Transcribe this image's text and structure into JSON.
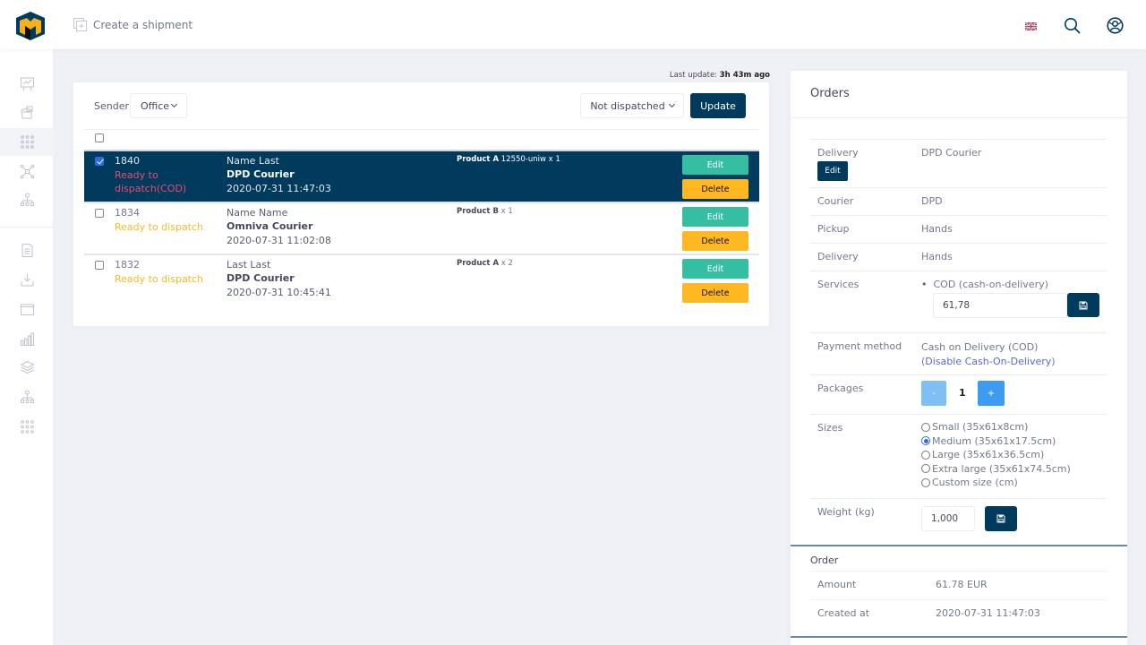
{
  "topbar": {
    "create_label": "Create a shipment",
    "icons": [
      "logo",
      "create-shipment-icon",
      "uk-flag-icon",
      "search-icon",
      "user-globe-icon"
    ]
  },
  "sidebar": {
    "items": [
      {
        "name": "dashboard",
        "icon": "presentation-chart-icon",
        "active": false
      },
      {
        "name": "packages",
        "icon": "boxes-icon",
        "active": false
      },
      {
        "name": "apps",
        "icon": "grid-dots-icon",
        "active": true
      },
      {
        "name": "network",
        "icon": "network-nodes-icon",
        "active": false
      },
      {
        "name": "hierarchy",
        "icon": "sitemap-icon",
        "active": false
      },
      {
        "name": "documents",
        "icon": "document-icon",
        "active": false
      },
      {
        "name": "import",
        "icon": "download-icon",
        "active": false
      },
      {
        "name": "windows",
        "icon": "window-icon",
        "active": false
      },
      {
        "name": "stats",
        "icon": "bar-chart-icon",
        "active": false
      },
      {
        "name": "layers",
        "icon": "layers-icon",
        "active": false
      },
      {
        "name": "structure",
        "icon": "sitemap-icon",
        "active": false
      },
      {
        "name": "more",
        "icon": "grid-dots-icon",
        "active": false
      }
    ]
  },
  "last_update": {
    "label": "Last update:",
    "value": "3h 43m ago"
  },
  "filters": {
    "sender_label": "Sender",
    "sender_value": "Office",
    "status_value": "Not dispatched",
    "update_label": "Update"
  },
  "orders": [
    {
      "id": "1840",
      "status": "Ready to dispatch(COD)",
      "status_type": "cod",
      "name": "Name Last",
      "courier": "DPD Courier",
      "date": "2020-07-31 11:47:03",
      "product": "Product A",
      "product_extra": "12550-uniw x 1",
      "selected": true,
      "edit_label": "Edit",
      "delete_label": "Delete"
    },
    {
      "id": "1834",
      "status": "Ready to dispatch",
      "status_type": "ready",
      "name": "Name Name",
      "courier": "Omniva Courier",
      "date": "2020-07-31 11:02:08",
      "product": "Product B",
      "product_extra": "x 1",
      "selected": false,
      "edit_label": "Edit",
      "delete_label": "Delete"
    },
    {
      "id": "1832",
      "status": "Ready to dispatch",
      "status_type": "ready",
      "name": "Last Last",
      "courier": "DPD Courier",
      "date": "2020-07-31 10:45:41",
      "product": "Product A",
      "product_extra": "x 2",
      "selected": false,
      "edit_label": "Edit",
      "delete_label": "Delete"
    }
  ],
  "details": {
    "title": "Orders",
    "delivery_label": "Delivery",
    "delivery_value": "DPD Courier",
    "delivery_edit": "Edit",
    "courier_label": "Courier",
    "courier_value": "DPD",
    "pickup_label": "Pickup",
    "pickup_value": "Hands",
    "delivery2_label": "Delivery",
    "delivery2_value": "Hands",
    "services_label": "Services",
    "service_item": "COD (cash-on-delivery)",
    "cod_amount": "61,78",
    "payment_label": "Payment method",
    "payment_value": "Cash on Delivery (COD)",
    "payment_link": "Disable Cash-On-Delivery",
    "packages_label": "Packages",
    "packages_minus": "-",
    "packages_count": "1",
    "packages_plus": "+",
    "sizes_label": "Sizes",
    "sizes": [
      {
        "label": "Small (35x61x8cm)",
        "selected": false
      },
      {
        "label": "Medium (35x61x17.5cm)",
        "selected": true
      },
      {
        "label": "Large (35x61x36.5cm)",
        "selected": false
      },
      {
        "label": "Extra large (35x61x74.5cm)",
        "selected": false
      },
      {
        "label": "Custom size (cm)",
        "selected": false
      }
    ],
    "weight_label": "Weight (kg)",
    "weight_value": "1,000"
  },
  "order_info": {
    "title": "Order",
    "amount_label": "Amount",
    "amount_value": "61.78 EUR",
    "created_label": "Created at",
    "created_value": "2020-07-31 11:47:03"
  },
  "colors": {
    "primary": "#003a5d",
    "edit": "#34bfa3",
    "delete": "#ffb822",
    "cod_status": "#e84c6c",
    "ready_status": "#ffb822",
    "link": "#5867dd",
    "pkg_minus": "#7fbff4",
    "pkg_plus": "#3d9bf2"
  }
}
